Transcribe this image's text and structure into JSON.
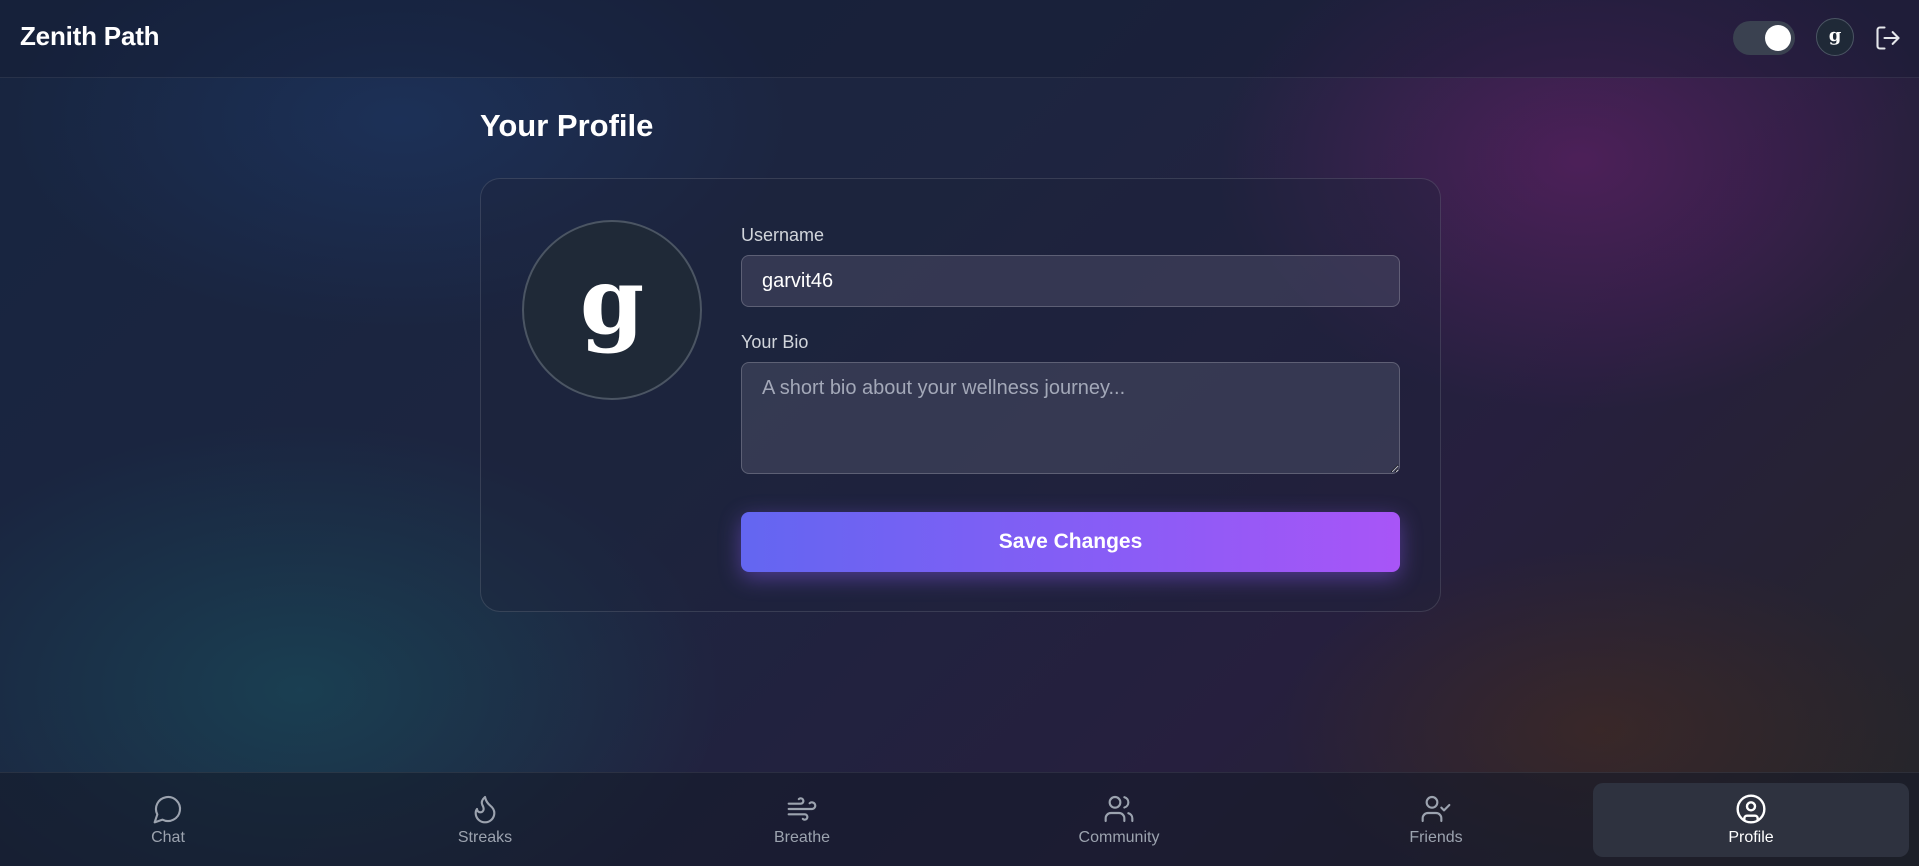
{
  "header": {
    "brand": "Zenith Path",
    "avatar_letter": "g"
  },
  "main": {
    "title": "Your Profile",
    "avatar_letter": "g",
    "username_label": "Username",
    "username_value": "garvit46",
    "bio_label": "Your Bio",
    "bio_placeholder": "A short bio about your wellness journey...",
    "save_label": "Save Changes"
  },
  "nav": {
    "items": [
      {
        "label": "Chat",
        "icon": "chat-icon"
      },
      {
        "label": "Streaks",
        "icon": "flame-icon"
      },
      {
        "label": "Breathe",
        "icon": "wind-icon"
      },
      {
        "label": "Community",
        "icon": "users-icon"
      },
      {
        "label": "Friends",
        "icon": "user-check-icon"
      },
      {
        "label": "Profile",
        "icon": "user-circle-icon"
      }
    ],
    "active": "Profile"
  },
  "colors": {
    "accent_start": "#6366f1",
    "accent_end": "#a855f7",
    "active_nav_bg": "#2e323f"
  }
}
